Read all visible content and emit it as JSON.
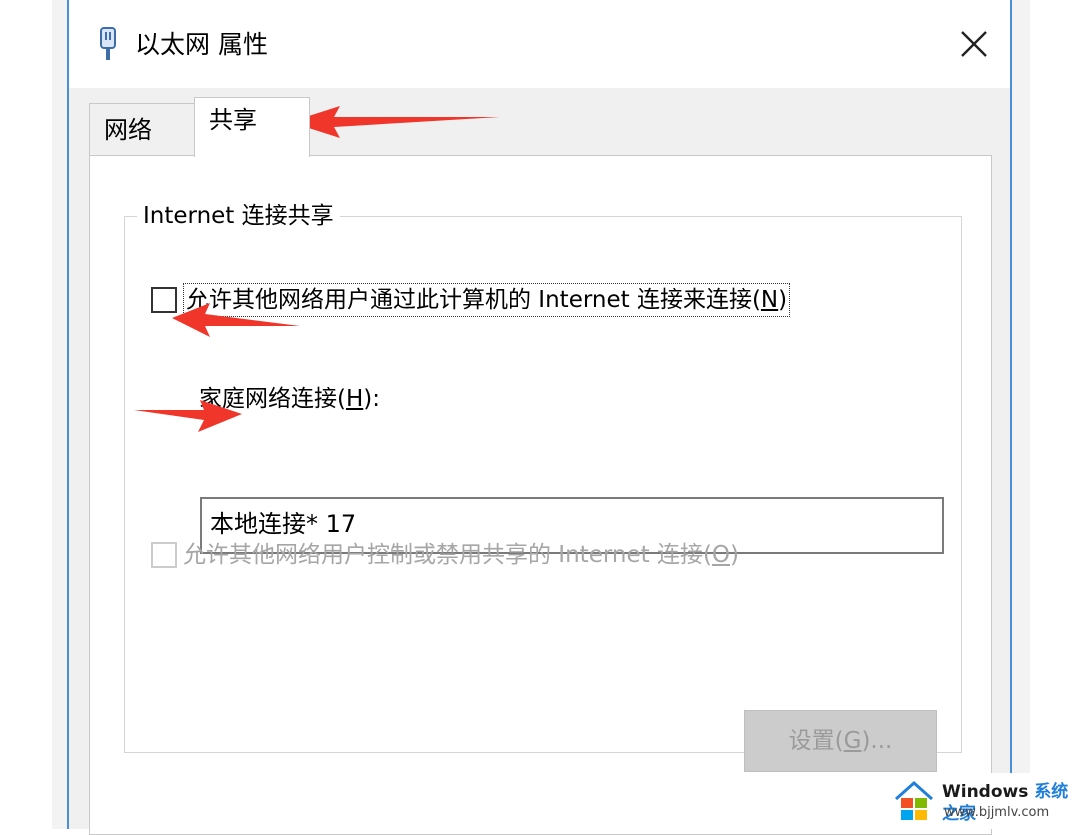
{
  "window": {
    "title": "以太网 属性",
    "close_label": "×"
  },
  "tabs": [
    {
      "label": "网络",
      "active": false
    },
    {
      "label": "共享",
      "active": true
    }
  ],
  "ics_group": {
    "legend": "Internet 连接共享",
    "allow_share": {
      "label_before": "允许其他网络用户通过此计算机的 Internet 连接来连接(",
      "mnemonic": "N",
      "label_after": ")",
      "checked": false
    },
    "home_network": {
      "label_before": "家庭网络连接(",
      "mnemonic": "H",
      "label_after": "):",
      "value": "本地连接* 17"
    },
    "allow_control": {
      "label_before": "允许其他网络用户控制或禁用共享的 Internet 连接(",
      "mnemonic": "O",
      "label_after": ")",
      "checked": false,
      "enabled": false
    },
    "settings_button": {
      "label_before": "设置(",
      "mnemonic": "G",
      "label_after": ")...",
      "enabled": false
    }
  },
  "watermark": {
    "brand": "Windows",
    "brand_cn": "系统之家",
    "url": "www.bjjmlv.com"
  },
  "colors": {
    "arrow": "#f0352a",
    "accent_border": "#4a90d9",
    "watermark_cn": "#1f7fd9"
  },
  "icons": {
    "title": "ethernet-adapter-icon",
    "close": "close-icon",
    "watermark": "windows-logo-icon"
  }
}
